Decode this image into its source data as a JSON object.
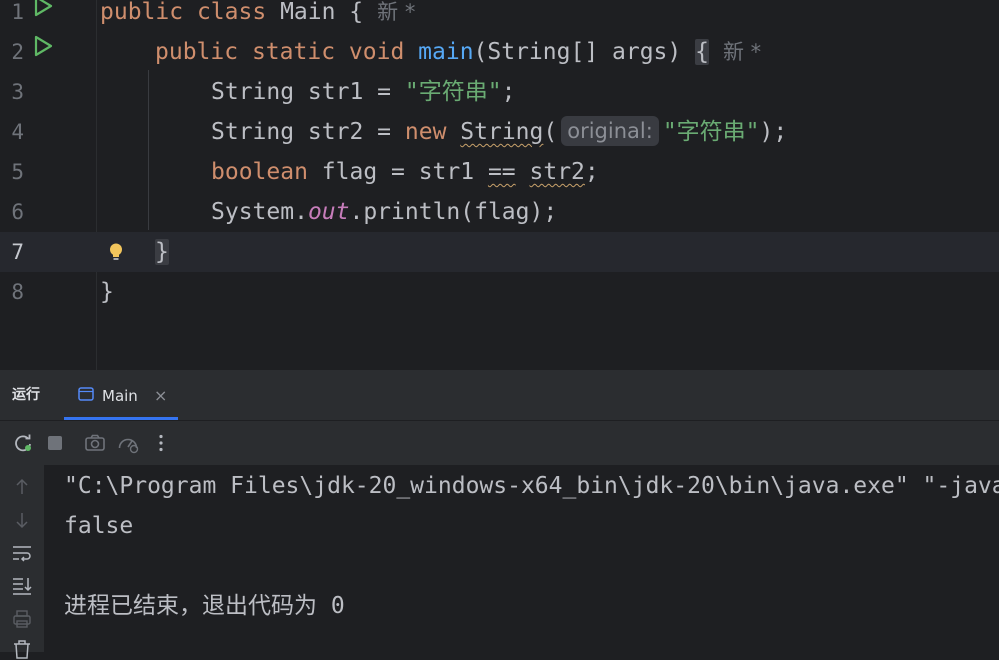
{
  "editor": {
    "annotation_new": "新 *",
    "lines": [
      {
        "num": "1"
      },
      {
        "num": "2"
      },
      {
        "num": "3"
      },
      {
        "num": "4"
      },
      {
        "num": "5"
      },
      {
        "num": "6"
      },
      {
        "num": "7"
      },
      {
        "num": "8"
      }
    ],
    "tokens": {
      "l1_kw1": "public",
      "l1_kw2": "class",
      "l1_name": "Main {",
      "l2_kw1": "public",
      "l2_kw2": "static",
      "l2_kw3": "void",
      "l2_fn": "main",
      "l2_rest": "(String[] args) ",
      "l2_brace": "{",
      "l3_a": "String str1 = ",
      "l3_str": "\"字符串\"",
      "l3_end": ";",
      "l4_a": "String str2 = ",
      "l4_kw": "new",
      "l4_cls": "String",
      "l4_paren": "(",
      "l4_hint": "original:",
      "l4_str": "\"字符串\"",
      "l4_end": ");",
      "l5_kw": "boolean",
      "l5_a": " flag = str1 ",
      "l5_op": "==",
      "l5_sp": " ",
      "l5_var": "str2",
      "l5_end": ";",
      "l6_a": "System.",
      "l6_fld": "out",
      "l6_b": ".println(flag);",
      "l7_brace": "}",
      "l8_brace": "}"
    }
  },
  "run_panel": {
    "title": "运行",
    "tab_label": "Main",
    "tab_close": "×",
    "console_lines": [
      "\"C:\\Program Files\\jdk-20_windows-x64_bin\\jdk-20\\bin\\java.exe\" \"-javaag",
      "false",
      "",
      "进程已结束，退出代码为 0"
    ]
  },
  "colors": {
    "keyword": "#cf8e6d",
    "function": "#56a8f5",
    "string": "#6aab73",
    "field": "#c77dbb",
    "run_green": "#5fb865",
    "accent": "#3574f0"
  },
  "icons": {
    "gutter_run": "run-icon",
    "intention": "lightbulb-icon",
    "toolbar": [
      "rerun-icon",
      "stop-icon",
      "camera-icon",
      "dashboard-icon",
      "more-icon"
    ],
    "side": [
      "arrow-up-icon",
      "arrow-down-icon",
      "soft-wrap-icon",
      "scroll-to-end-icon",
      "print-icon",
      "trash-icon"
    ]
  }
}
